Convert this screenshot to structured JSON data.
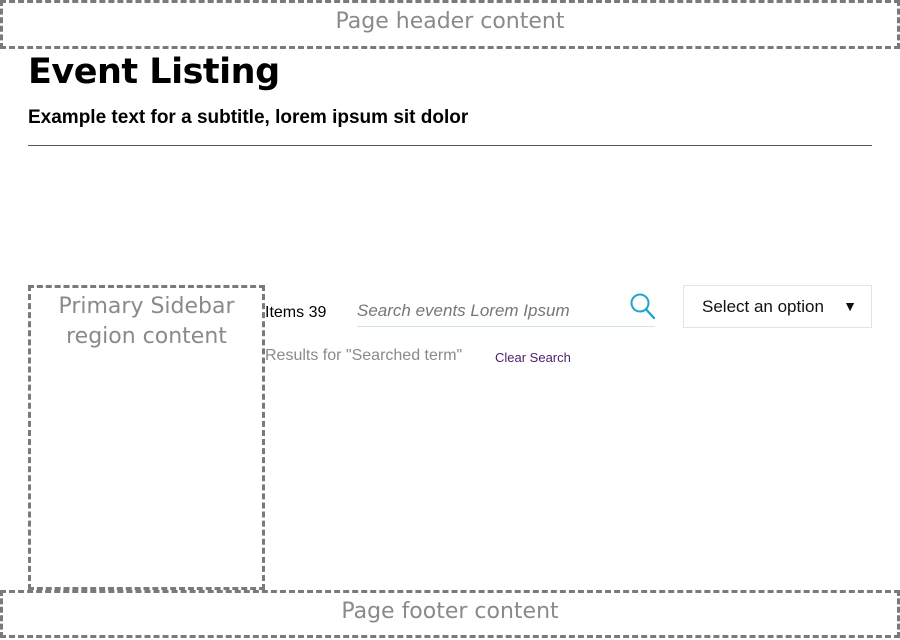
{
  "page_header": {
    "text": "Page header content"
  },
  "page_footer": {
    "text": "Page footer content"
  },
  "sidebar": {
    "line1": "Primary Sidebar",
    "line2": "region content"
  },
  "heading": {
    "title": "Event Listing",
    "subtitle": "Example text for a subtitle, lorem ipsum sit dolor"
  },
  "toolbar": {
    "items_label": "Items",
    "items_count": "39",
    "search_placeholder": "Search events Lorem Ipsum",
    "search_icon": "search-icon",
    "select_value": "Select an option",
    "select_caret": "▼"
  },
  "results": {
    "text": "Results for \"Searched term\"",
    "clear_label": "Clear Search"
  },
  "colors": {
    "accent_search_icon": "#1aa7c9",
    "link": "#4a1f6b",
    "region_border": "#7a7a7a"
  }
}
